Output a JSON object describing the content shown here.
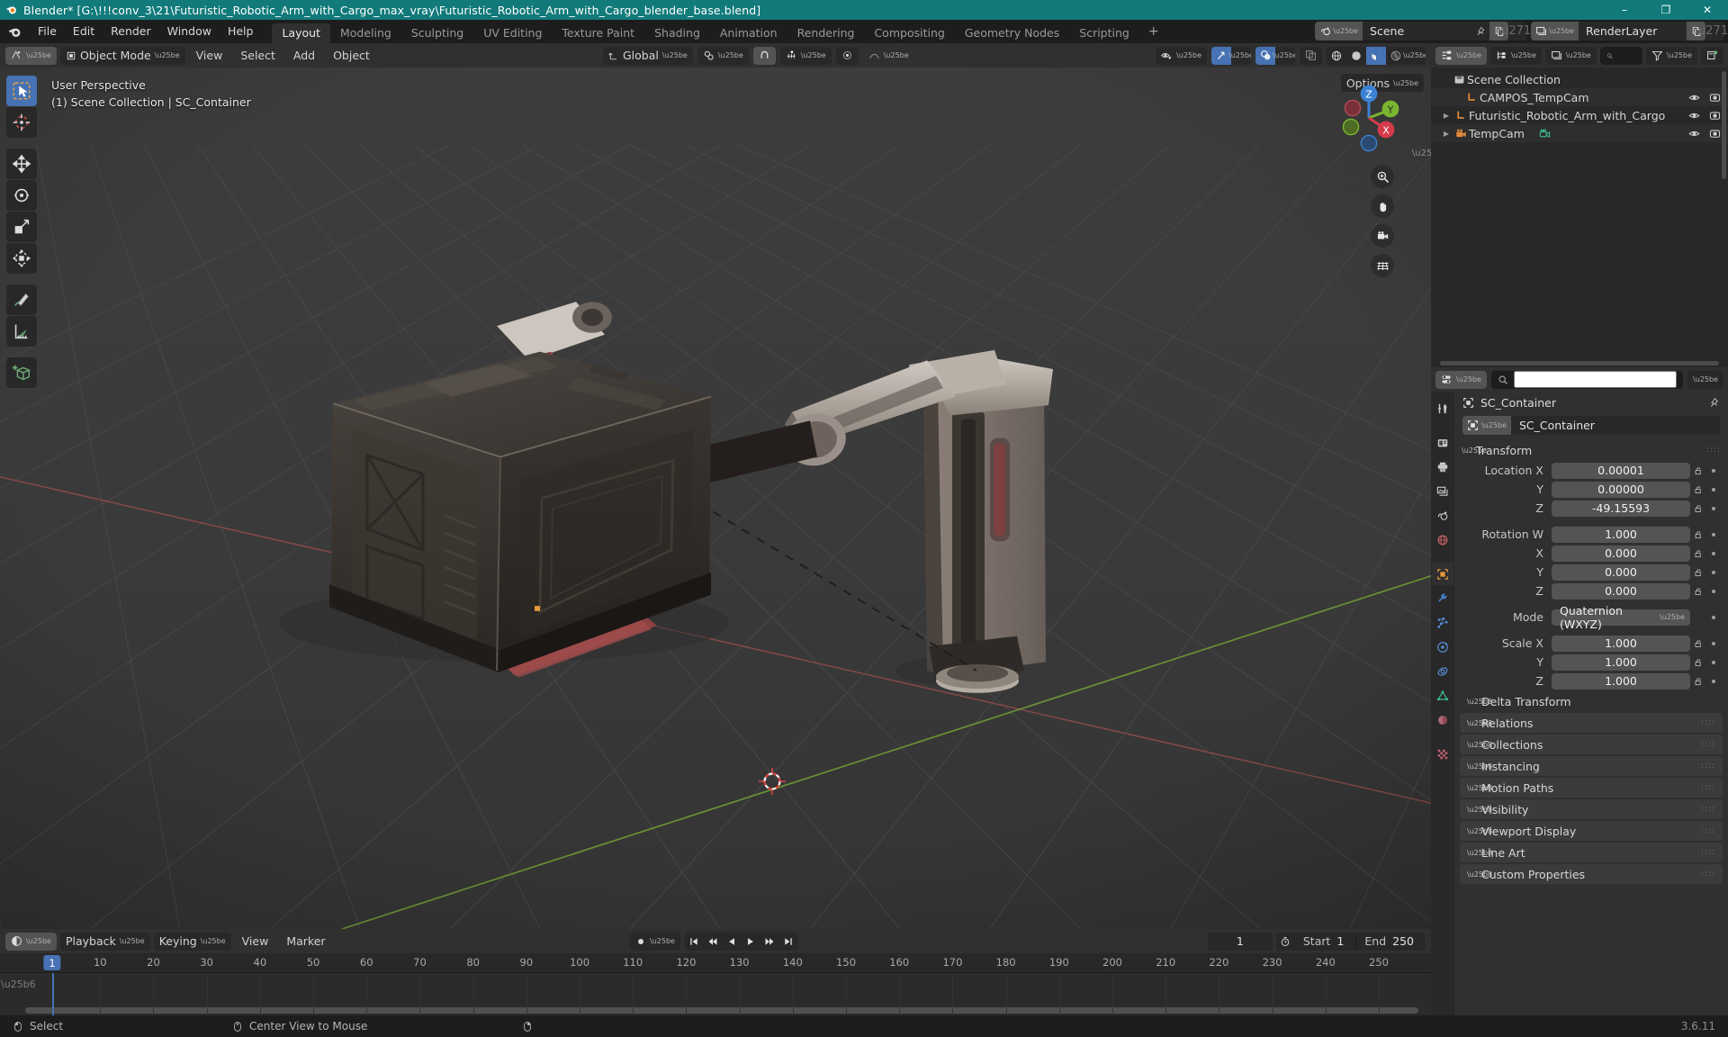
{
  "titlebar": {
    "text": "Blender* [G:\\!!!conv_3\\21\\Futuristic_Robotic_Arm_with_Cargo_max_vray\\Futuristic_Robotic_Arm_with_Cargo_blender_base.blend]",
    "minimize": "–",
    "maximize": "❐",
    "close": "✕"
  },
  "topbar": {
    "menus": [
      "File",
      "Edit",
      "Render",
      "Window",
      "Help"
    ],
    "workspaces": [
      {
        "label": "Layout",
        "active": true
      },
      {
        "label": "Modeling",
        "active": false
      },
      {
        "label": "Sculpting",
        "active": false
      },
      {
        "label": "UV Editing",
        "active": false
      },
      {
        "label": "Texture Paint",
        "active": false
      },
      {
        "label": "Shading",
        "active": false
      },
      {
        "label": "Animation",
        "active": false
      },
      {
        "label": "Rendering",
        "active": false
      },
      {
        "label": "Compositing",
        "active": false
      },
      {
        "label": "Geometry Nodes",
        "active": false
      },
      {
        "label": "Scripting",
        "active": false
      }
    ],
    "add_workspace": "+",
    "scene_name": "Scene",
    "viewlayer_name": "RenderLayer"
  },
  "viewport": {
    "mode": "Object Mode",
    "menus": [
      "View",
      "Select",
      "Add",
      "Object"
    ],
    "transform_orientation": "Global",
    "options_label": "Options",
    "overlay_line1": "User Perspective",
    "overlay_line2": "(1) Scene Collection | SC_Container",
    "gizmo_axes": {
      "x": "X",
      "y": "Y",
      "z": "Z"
    },
    "tools": [
      "select-box-tool",
      "cursor-tool",
      "move-tool",
      "rotate-tool",
      "scale-tool",
      "transform-tool",
      "annotate-tool",
      "measure-tool",
      "add-cube-tool"
    ],
    "nav_buttons": [
      "zoom-icon",
      "pan-hand-icon",
      "camera-view-icon",
      "toggle-ortho-icon"
    ],
    "shading_modes": [
      "wireframe",
      "solid",
      "material-preview",
      "rendered"
    ],
    "active_shading_mode": "material-preview"
  },
  "outliner": {
    "rows": [
      {
        "label": "Scene Collection",
        "icon": "collection-icon",
        "indent": 0,
        "disclosure": "",
        "has_eye": false
      },
      {
        "label": "CAMPOS_TempCam",
        "icon": "empty-axes-icon",
        "indent": 1,
        "disclosure": "",
        "has_eye": true
      },
      {
        "label": "Futuristic_Robotic_Arm_with_Cargo",
        "icon": "empty-axes-icon",
        "indent": 1,
        "disclosure": "▶",
        "has_eye": true
      },
      {
        "label": "TempCam",
        "icon": "camera-data-icon",
        "indent": 1,
        "disclosure": "▶",
        "has_eye": true,
        "extra_icon": "camera-green-icon"
      }
    ],
    "search_placeholder": ""
  },
  "properties": {
    "search_placeholder": "",
    "breadcrumb": "SC_Container",
    "object_name": "SC_Container",
    "transform_panel": "Transform",
    "fields": [
      {
        "label": "Location X",
        "value": "0.00001"
      },
      {
        "label": "Y",
        "value": "0.00000"
      },
      {
        "label": "Z",
        "value": "-49.15593"
      },
      {
        "label": "Rotation W",
        "value": "1.000"
      },
      {
        "label": "X",
        "value": "0.000"
      },
      {
        "label": "Y",
        "value": "0.000"
      },
      {
        "label": "Z",
        "value": "0.000"
      }
    ],
    "mode_label": "Mode",
    "mode_value": "Quaternion (WXYZ)",
    "scale_fields": [
      {
        "label": "Scale X",
        "value": "1.000"
      },
      {
        "label": "Y",
        "value": "1.000"
      },
      {
        "label": "Z",
        "value": "1.000"
      }
    ],
    "delta_transform": "Delta Transform",
    "panels": [
      "Relations",
      "Collections",
      "Instancing",
      "Motion Paths",
      "Visibility",
      "Viewport Display",
      "Line Art",
      "Custom Properties"
    ],
    "tabs": [
      "tool-tab",
      "render-tab",
      "output-tab",
      "view-layer-tab",
      "scene-tab",
      "world-tab",
      "object-tab",
      "modifiers-tab",
      "particles-tab",
      "physics-tab",
      "constraints-tab",
      "data-tab",
      "material-tab",
      "texture-tab"
    ],
    "active_tab": "object-tab"
  },
  "timeline": {
    "menus": [
      "Playback",
      "Keying",
      "View",
      "Marker"
    ],
    "current_frame": "1",
    "start_label": "Start",
    "start_value": "1",
    "end_label": "End",
    "end_value": "250",
    "ticks": [
      10,
      20,
      30,
      40,
      50,
      60,
      70,
      80,
      90,
      100,
      110,
      120,
      130,
      140,
      150,
      160,
      170,
      180,
      190,
      200,
      210,
      220,
      230,
      240,
      250
    ]
  },
  "statusbar": {
    "items": [
      {
        "icon": "mouse-left-icon",
        "label": "Select"
      },
      {
        "icon": "mouse-middle-icon",
        "label": "Center View to Mouse"
      },
      {
        "icon": "mouse-right-icon",
        "label": ""
      }
    ],
    "version": "3.6.11"
  },
  "colors": {
    "title_bar": "#127a7a",
    "accent_blue": "#4772b3",
    "object_orange": "#e8983a",
    "axis_x_red": "#c44a4a",
    "axis_y_green": "#7fb53a",
    "viewport_bg": "#3b3b3b"
  }
}
